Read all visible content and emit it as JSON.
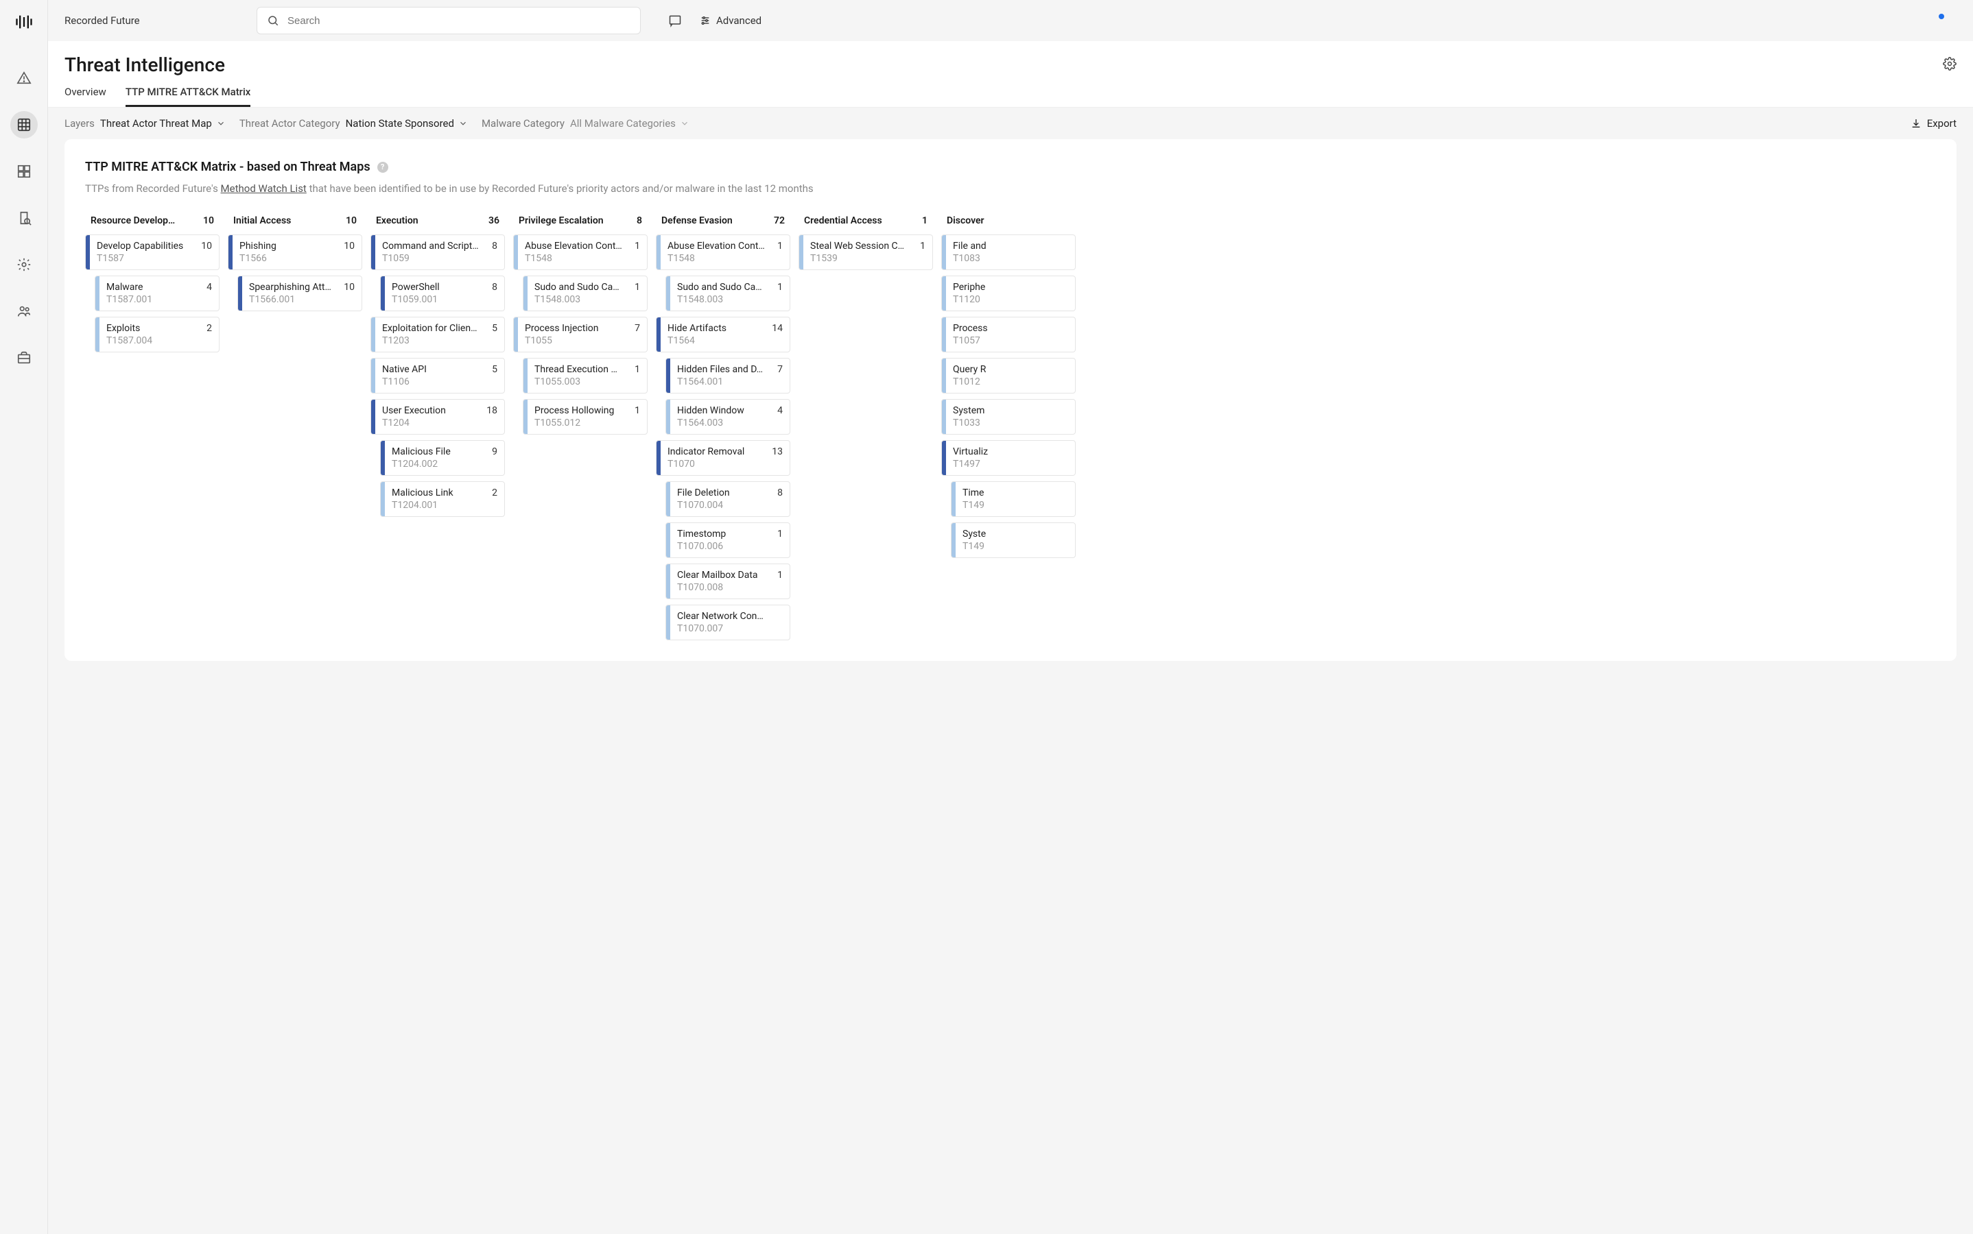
{
  "brand": "Recorded Future",
  "search": {
    "placeholder": "Search"
  },
  "advanced_label": "Advanced",
  "page_title": "Threat Intelligence",
  "tabs": [
    {
      "label": "Overview",
      "active": false
    },
    {
      "label": "TTP MITRE ATT&CK Matrix",
      "active": true
    }
  ],
  "filters": {
    "layers": {
      "label": "Layers",
      "value": "Threat Actor Threat Map"
    },
    "actor_category": {
      "label": "Threat Actor Category",
      "value": "Nation State Sponsored"
    },
    "malware_category": {
      "label": "Malware Category",
      "value": "All Malware Categories"
    }
  },
  "export_label": "Export",
  "card": {
    "title": "TTP MITRE ATT&CK Matrix - based on Threat Maps",
    "subtitle_pre": "TTPs from Recorded Future's ",
    "subtitle_link": "Method Watch List",
    "subtitle_post": " that have been identified to be in use by Recorded Future's priority actors and/or malware in the last 12 months"
  },
  "matrix": [
    {
      "name": "Resource Develop…",
      "count": 10,
      "items": [
        {
          "name": "Develop Capabilities",
          "id": "T1587",
          "count": 10,
          "bar": "dark",
          "sub": false
        },
        {
          "name": "Malware",
          "id": "T1587.001",
          "count": 4,
          "bar": "light",
          "sub": true
        },
        {
          "name": "Exploits",
          "id": "T1587.004",
          "count": 2,
          "bar": "light",
          "sub": true
        }
      ]
    },
    {
      "name": "Initial Access",
      "count": 10,
      "items": [
        {
          "name": "Phishing",
          "id": "T1566",
          "count": 10,
          "bar": "dark",
          "sub": false
        },
        {
          "name": "Spearphishing Att…",
          "id": "T1566.001",
          "count": 10,
          "bar": "dark",
          "sub": true
        }
      ]
    },
    {
      "name": "Execution",
      "count": 36,
      "items": [
        {
          "name": "Command and Script…",
          "id": "T1059",
          "count": 8,
          "bar": "dark",
          "sub": false
        },
        {
          "name": "PowerShell",
          "id": "T1059.001",
          "count": 8,
          "bar": "dark",
          "sub": true
        },
        {
          "name": "Exploitation for Clien…",
          "id": "T1203",
          "count": 5,
          "bar": "light",
          "sub": false
        },
        {
          "name": "Native API",
          "id": "T1106",
          "count": 5,
          "bar": "light",
          "sub": false
        },
        {
          "name": "User Execution",
          "id": "T1204",
          "count": 18,
          "bar": "dark",
          "sub": false
        },
        {
          "name": "Malicious File",
          "id": "T1204.002",
          "count": 9,
          "bar": "dark",
          "sub": true
        },
        {
          "name": "Malicious Link",
          "id": "T1204.001",
          "count": 2,
          "bar": "light",
          "sub": true
        }
      ]
    },
    {
      "name": "Privilege Escalation",
      "count": 8,
      "items": [
        {
          "name": "Abuse Elevation Cont…",
          "id": "T1548",
          "count": 1,
          "bar": "light",
          "sub": false
        },
        {
          "name": "Sudo and Sudo Ca…",
          "id": "T1548.003",
          "count": 1,
          "bar": "light",
          "sub": true
        },
        {
          "name": "Process Injection",
          "id": "T1055",
          "count": 7,
          "bar": "light",
          "sub": false
        },
        {
          "name": "Thread Execution …",
          "id": "T1055.003",
          "count": 1,
          "bar": "light",
          "sub": true
        },
        {
          "name": "Process Hollowing",
          "id": "T1055.012",
          "count": 1,
          "bar": "light",
          "sub": true
        }
      ]
    },
    {
      "name": "Defense Evasion",
      "count": 72,
      "items": [
        {
          "name": "Abuse Elevation Cont…",
          "id": "T1548",
          "count": 1,
          "bar": "light",
          "sub": false
        },
        {
          "name": "Sudo and Sudo Ca…",
          "id": "T1548.003",
          "count": 1,
          "bar": "light",
          "sub": true
        },
        {
          "name": "Hide Artifacts",
          "id": "T1564",
          "count": 14,
          "bar": "dark",
          "sub": false
        },
        {
          "name": "Hidden Files and D…",
          "id": "T1564.001",
          "count": 7,
          "bar": "dark",
          "sub": true
        },
        {
          "name": "Hidden Window",
          "id": "T1564.003",
          "count": 4,
          "bar": "light",
          "sub": true
        },
        {
          "name": "Indicator Removal",
          "id": "T1070",
          "count": 13,
          "bar": "dark",
          "sub": false
        },
        {
          "name": "File Deletion",
          "id": "T1070.004",
          "count": 8,
          "bar": "light",
          "sub": true
        },
        {
          "name": "Timestomp",
          "id": "T1070.006",
          "count": 1,
          "bar": "light",
          "sub": true
        },
        {
          "name": "Clear Mailbox Data",
          "id": "T1070.008",
          "count": 1,
          "bar": "light",
          "sub": true
        },
        {
          "name": "Clear Network Con…",
          "id": "T1070.007",
          "count": "",
          "bar": "light",
          "sub": true
        }
      ]
    },
    {
      "name": "Credential Access",
      "count": 1,
      "items": [
        {
          "name": "Steal Web Session C…",
          "id": "T1539",
          "count": 1,
          "bar": "light",
          "sub": false
        }
      ]
    },
    {
      "name": "Discover",
      "items": [
        {
          "name": "File and",
          "id": "T1083",
          "bar": "light",
          "sub": false
        },
        {
          "name": "Periphe",
          "id": "T1120",
          "bar": "light",
          "sub": false
        },
        {
          "name": "Process",
          "id": "T1057",
          "bar": "light",
          "sub": false
        },
        {
          "name": "Query R",
          "id": "T1012",
          "bar": "light",
          "sub": false
        },
        {
          "name": "System",
          "id": "T1033",
          "bar": "light",
          "sub": false
        },
        {
          "name": "Virtualiz",
          "id": "T1497",
          "bar": "dark",
          "sub": false
        },
        {
          "name": "Time",
          "id": "T149",
          "bar": "light",
          "sub": true
        },
        {
          "name": "Syste",
          "id": "T149",
          "bar": "light",
          "sub": true
        }
      ]
    }
  ]
}
